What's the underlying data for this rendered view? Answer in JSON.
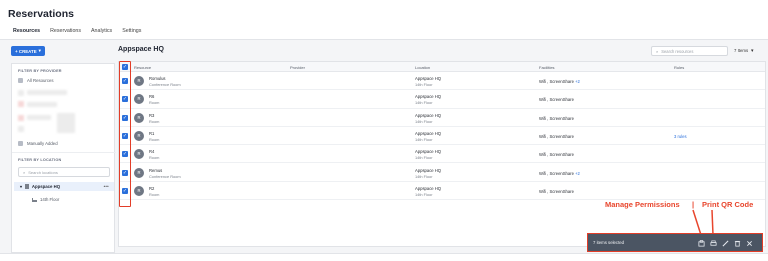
{
  "app": {
    "title": "Reservations"
  },
  "tabs": [
    "Resources",
    "Reservations",
    "Analytics",
    "Settings"
  ],
  "sidebar": {
    "create_label": "+ CREATE",
    "filter_provider_label": "FILTER BY PROVIDER",
    "all_resources": "All Resources",
    "manually_added": "Manually Added",
    "filter_location_label": "FILTER BY LOCATION",
    "search_placeholder": "Search locations",
    "tree": {
      "root": "Appspace HQ",
      "child": "14th Floor",
      "more": "•••"
    }
  },
  "main": {
    "title": "Appspace HQ",
    "search_placeholder": "Search resources",
    "items_count": "7 Items"
  },
  "table": {
    "headers": {
      "resource": "Resource",
      "provider": "Provider",
      "location": "Location",
      "facilities": "Facilities",
      "rules": "Rules"
    },
    "rows": [
      {
        "initials": "R",
        "name": "Romulus",
        "type": "Conference Room",
        "loc": "Appspace HQ",
        "floor": "14th Floor",
        "facilities": "Wifi , ScreenShare",
        "plus": "+2",
        "rules": ""
      },
      {
        "initials": "R",
        "name": "R6",
        "type": "Room",
        "loc": "Appspace HQ",
        "floor": "14th Floor",
        "facilities": "Wifi , ScreenShare",
        "plus": "",
        "rules": ""
      },
      {
        "initials": "R",
        "name": "R3",
        "type": "Room",
        "loc": "Appspace HQ",
        "floor": "14th Floor",
        "facilities": "Wifi , ScreenShare",
        "plus": "",
        "rules": ""
      },
      {
        "initials": "R",
        "name": "R1",
        "type": "Room",
        "loc": "Appspace HQ",
        "floor": "14th Floor",
        "facilities": "Wifi , ScreenShare",
        "plus": "",
        "rules": "3 rules"
      },
      {
        "initials": "R",
        "name": "R4",
        "type": "Room",
        "loc": "Appspace HQ",
        "floor": "14th Floor",
        "facilities": "Wifi , ScreenShare",
        "plus": "",
        "rules": ""
      },
      {
        "initials": "R",
        "name": "Remus",
        "type": "Conference Room",
        "loc": "Appspace HQ",
        "floor": "14th Floor",
        "facilities": "Wifi , ScreenShare",
        "plus": "+2",
        "rules": ""
      },
      {
        "initials": "R",
        "name": "R2",
        "type": "Room",
        "loc": "Appspace HQ",
        "floor": "14th Floor",
        "facilities": "Wifi , ScreenShare",
        "plus": "",
        "rules": ""
      }
    ]
  },
  "annotations": {
    "manage": "Manage Permissions",
    "separator": "|",
    "print": "Print QR Code"
  },
  "selection_bar": {
    "text": "7 items selected"
  },
  "colors": {
    "accent": "#2a6fdb",
    "annotation": "#e23d28",
    "selection_bar": "#4b5563"
  }
}
